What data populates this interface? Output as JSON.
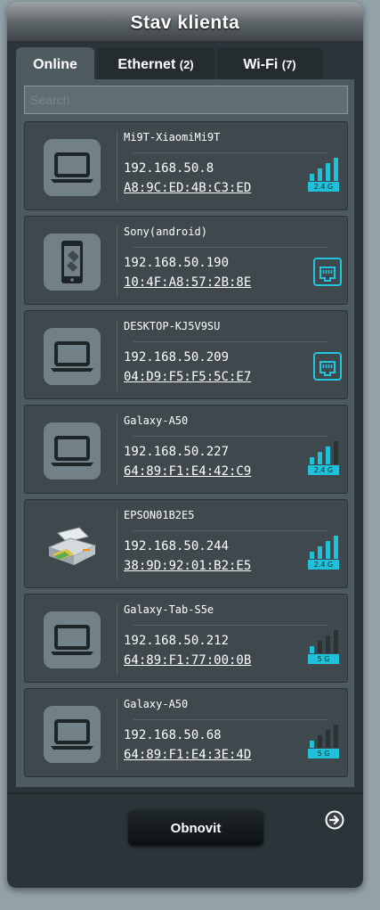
{
  "window": {
    "title": "Stav klienta"
  },
  "tabs": [
    {
      "label": "Online",
      "count": "",
      "active": true
    },
    {
      "label": "Ethernet",
      "count": "(2)",
      "active": false
    },
    {
      "label": "Wi-Fi",
      "count": "(7)",
      "active": false
    }
  ],
  "search": {
    "placeholder": "Search",
    "value": ""
  },
  "clients": [
    {
      "name": "Mi9T-XiaomiMi9T",
      "ip": "192.168.50.8",
      "mac": "A8:9C:ED:4B:C3:ED",
      "device_icon": "laptop-icon",
      "connection": "wifi",
      "band": "2.4 G",
      "signal_level": 4
    },
    {
      "name": "Sony(android)",
      "ip": "192.168.50.190",
      "mac": "10:4F:A8:57:2B:8E",
      "device_icon": "phone-icon",
      "connection": "wired",
      "band": "",
      "signal_level": 0
    },
    {
      "name": "DESKTOP-KJ5V9SU",
      "ip": "192.168.50.209",
      "mac": "04:D9:F5:F5:5C:E7",
      "device_icon": "laptop-icon",
      "connection": "wired",
      "band": "",
      "signal_level": 0
    },
    {
      "name": "Galaxy-A50",
      "ip": "192.168.50.227",
      "mac": "64:89:F1:E4:42:C9",
      "device_icon": "laptop-icon",
      "connection": "wifi",
      "band": "2.4 G",
      "signal_level": 3
    },
    {
      "name": "EPSON01B2E5",
      "ip": "192.168.50.244",
      "mac": "38:9D:92:01:B2:E5",
      "device_icon": "printer-icon",
      "connection": "wifi",
      "band": "2.4 G",
      "signal_level": 4
    },
    {
      "name": "Galaxy-Tab-S5e",
      "ip": "192.168.50.212",
      "mac": "64:89:F1:77:00:0B",
      "device_icon": "laptop-icon",
      "connection": "wifi",
      "band": "5 G",
      "signal_level": 1
    },
    {
      "name": "Galaxy-A50",
      "ip": "192.168.50.68",
      "mac": "64:89:F1:E4:3E:4D",
      "device_icon": "laptop-icon",
      "connection": "wifi",
      "band": "5 G",
      "signal_level": 1
    }
  ],
  "actions": {
    "refresh_label": "Obnovit"
  },
  "colors": {
    "accent": "#1fc0d8",
    "panel": "#2b3439",
    "card": "#3e484d"
  }
}
